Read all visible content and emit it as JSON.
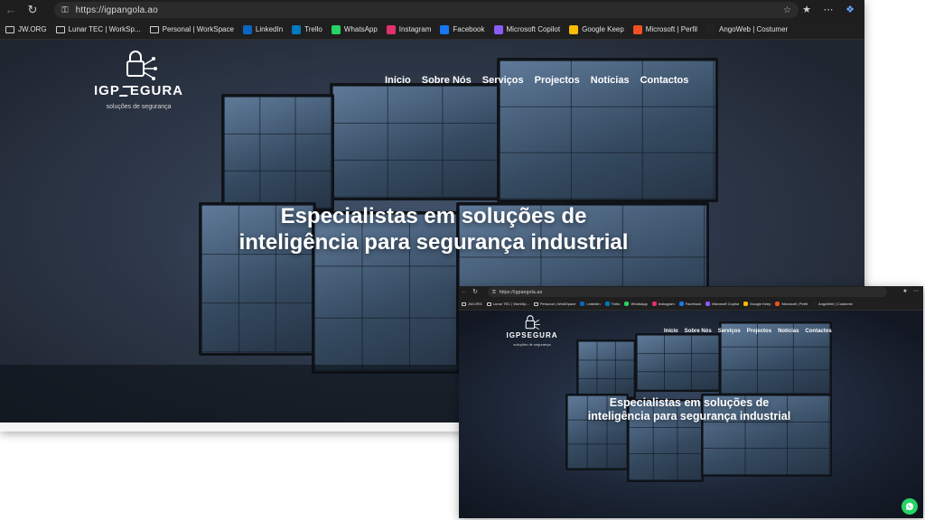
{
  "browser": {
    "url": "https://igpangola.ao",
    "bookmarks": [
      {
        "label": "JW.ORG",
        "icon": "folder-icon"
      },
      {
        "label": "Lunar TEC | WorkSp...",
        "icon": "folder-icon"
      },
      {
        "label": "Personal | WorkSpace",
        "icon": "folder-icon"
      },
      {
        "label": "LinkedIn",
        "icon": "linkedin-icon",
        "color": "#0a66c2"
      },
      {
        "label": "Trello",
        "icon": "trello-icon",
        "color": "#0079bf"
      },
      {
        "label": "WhatsApp",
        "icon": "whatsapp-icon",
        "color": "#25d366"
      },
      {
        "label": "Instagram",
        "icon": "instagram-icon",
        "color": "#e1306c"
      },
      {
        "label": "Facebook",
        "icon": "facebook-icon",
        "color": "#1877f2"
      },
      {
        "label": "Microsoft Copilot",
        "icon": "copilot-icon",
        "color": "#8a5cf6"
      },
      {
        "label": "Google Keep",
        "icon": "keep-icon",
        "color": "#fbbc04"
      },
      {
        "label": "Microsoft | Perfil",
        "icon": "microsoft-icon",
        "color": "#f25022"
      },
      {
        "label": "AngoWeb | Costumer",
        "icon": "angoweb-icon",
        "color": "#222222"
      }
    ]
  },
  "site": {
    "logo_name_left": "IGP",
    "logo_name_right": "EGURA",
    "logo_tagline": "soluções de segurança",
    "menu": [
      "Início",
      "Sobre Nós",
      "Serviços",
      "Projectos",
      "Notícias",
      "Contactos"
    ],
    "headline_line1": "Especialistas em soluções de",
    "headline_line2": "inteligência para segurança industrial"
  },
  "colors": {
    "whatsapp": "#25d366",
    "browser_bg": "#1f1f1f"
  }
}
